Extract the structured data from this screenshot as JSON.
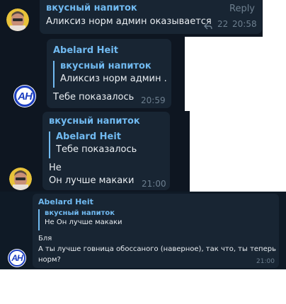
{
  "messages": [
    {
      "sender": "вкусный напиток",
      "text": "Аликсиз норм админ оказывается",
      "reply_action": "Reply",
      "reply_count": "22",
      "time": "20:58"
    },
    {
      "sender": "Abelard Heit",
      "quote_name": "вкусный напиток",
      "quote_text": "Аликсиз норм админ ...",
      "text": "Тебе показалось",
      "time": "20:59",
      "avatar_letters": "AH"
    },
    {
      "sender": "вкусный напиток",
      "quote_name": "Abelard Heit",
      "quote_text": "Тебе показалось",
      "line1": "Не",
      "line2": "Он лучше макаки",
      "time": "21:00"
    },
    {
      "sender": "Abelard Heit",
      "quote_name": "вкусный напиток",
      "quote_text": "Не Он лучше макаки",
      "line1": "Бля",
      "line2": "А ты лучше говница обоссаного (наверное), так что, ты теперь",
      "line3": "норм?",
      "time": "21:00",
      "avatar_letters": "AH"
    }
  ],
  "colors": {
    "background": "#0e1621",
    "bubble": "#182533",
    "accent": "#71baf1",
    "text": "#e9edf1",
    "meta": "#6d7f8f"
  }
}
